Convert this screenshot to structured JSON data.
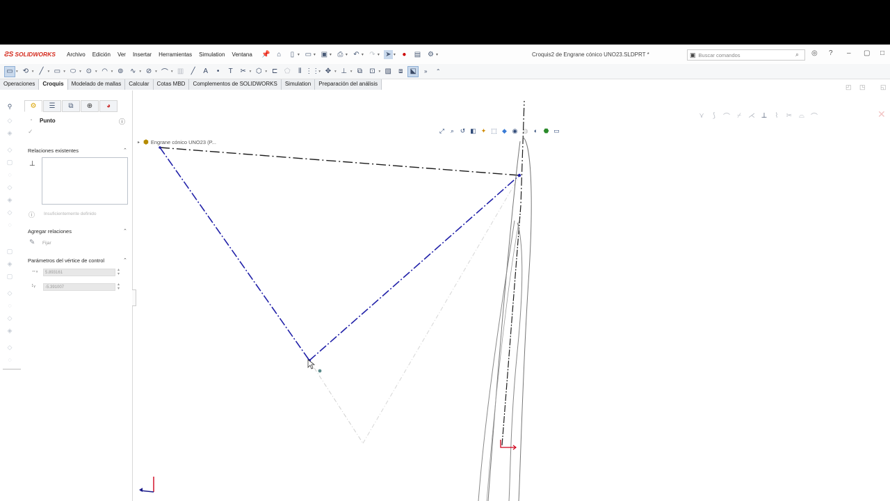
{
  "app": {
    "logo_text": "SOLIDWORKS",
    "document_title": "Croquis2 de Engrane cónico UNO23.SLDPRT *"
  },
  "menu": {
    "items": [
      "Archivo",
      "Edición",
      "Ver",
      "Insertar",
      "Herramientas",
      "Simulation",
      "Ventana"
    ]
  },
  "search": {
    "placeholder": "Buscar comandos"
  },
  "tabs": [
    {
      "label": "Operaciones",
      "active": false
    },
    {
      "label": "Croquis",
      "active": true
    },
    {
      "label": "Modelado de mallas",
      "active": false
    },
    {
      "label": "Calcular",
      "active": false
    },
    {
      "label": "Cotas MBD",
      "active": false
    },
    {
      "label": "Complementos de SOLIDWORKS",
      "active": false
    },
    {
      "label": "Simulation",
      "active": false
    },
    {
      "label": "Preparación del análisis",
      "active": false
    }
  ],
  "property_manager": {
    "title": "Punto",
    "existing_relations": {
      "header": "Relaciones existentes",
      "status": "Insuficientemente definido"
    },
    "add_relations": {
      "header": "Agregar relaciones",
      "fix_label": "Fijar"
    },
    "control_vertex": {
      "header": "Parámetros del vértice de control",
      "x_value": "5.893161",
      "y_value": "-5.391007"
    }
  },
  "feature_tree": {
    "root_label": "Engrane cónico UNO23 (P..."
  },
  "colors": {
    "brand": "#d52b1e",
    "sketch_active": "#1a1aa8",
    "sketch_line": "#111111",
    "construction": "#c8c8c8",
    "origin": "#d0021b"
  }
}
